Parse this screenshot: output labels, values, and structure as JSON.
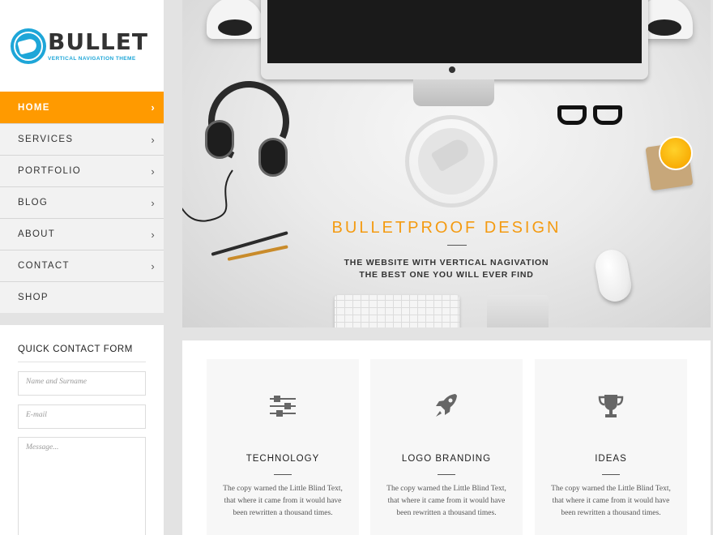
{
  "brand": {
    "name": "BULLET",
    "tagline": "VERTICAL NAVIGATION THEME",
    "accent_color": "#ff9a00",
    "logo_color": "#1ea6d8"
  },
  "nav": {
    "items": [
      {
        "label": "HOME",
        "active": true
      },
      {
        "label": "SERVICES"
      },
      {
        "label": "PORTFOLIO"
      },
      {
        "label": "BLOG"
      },
      {
        "label": "ABOUT"
      },
      {
        "label": "CONTACT"
      },
      {
        "label": "SHOP"
      }
    ],
    "chevron_icon": "chevron-right-icon"
  },
  "contact_form": {
    "title": "QUICK CONTACT FORM",
    "name_placeholder": "Name and Surname",
    "email_placeholder": "E-mail",
    "message_placeholder": "Message..."
  },
  "hero": {
    "title": "BULLETPROOF DESIGN",
    "subtitle_line1": "THE WEBSITE WITH VERTICAL NAGIVATION",
    "subtitle_line2": "THE BEST ONE YOU WILL EVER FIND"
  },
  "features": [
    {
      "icon": "sliders-icon",
      "title": "TECHNOLOGY",
      "text": "The copy warned the Little Blind Text, that where it came from it would have been rewritten a thousand times."
    },
    {
      "icon": "rocket-icon",
      "title": "LOGO BRANDING",
      "text": "The copy warned the Little Blind Text, that where it came from it would have been rewritten a thousand times."
    },
    {
      "icon": "trophy-icon",
      "title": "IDEAS",
      "text": "The copy warned the Little Blind Text, that where it came from it would have been rewritten a thousand times."
    }
  ]
}
